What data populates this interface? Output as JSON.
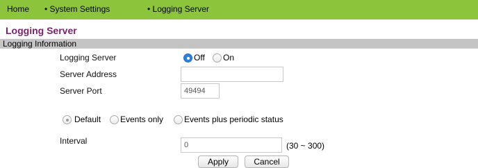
{
  "breadcrumb": {
    "items": [
      {
        "label": "Home"
      },
      {
        "label": "• System Settings"
      },
      {
        "label": "• Logging Server"
      }
    ]
  },
  "page": {
    "title": "Logging Server",
    "section_title": "Logging Information"
  },
  "form": {
    "logging_server": {
      "label": "Logging Server",
      "options": [
        {
          "label": "Off",
          "selected": true
        },
        {
          "label": "On",
          "selected": false
        }
      ]
    },
    "server_address": {
      "label": "Server Address",
      "value": ""
    },
    "server_port": {
      "label": "Server Port",
      "value": "49494"
    },
    "mode": {
      "options": [
        {
          "label": "Default",
          "selected": true
        },
        {
          "label": "Events only",
          "selected": false
        },
        {
          "label": "Events plus periodic status",
          "selected": false
        }
      ]
    },
    "interval": {
      "label": "Interval",
      "value": "0",
      "range_hint": "(30 ~ 300)"
    }
  },
  "buttons": {
    "apply": "Apply",
    "cancel": "Cancel"
  },
  "colors": {
    "breadcrumb_bar": "#8cc43c",
    "title": "#7a1f6b",
    "section_bar": "#c4c4c4",
    "radio_selected": "#2f7fe0"
  }
}
